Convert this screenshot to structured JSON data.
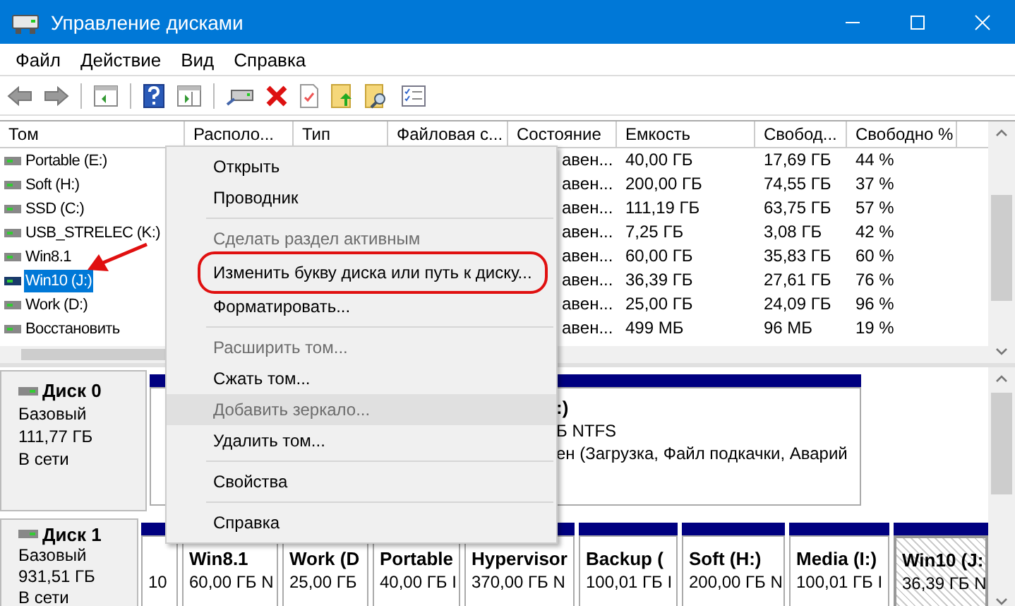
{
  "window": {
    "title": "Управление дисками"
  },
  "menu": [
    "Файл",
    "Действие",
    "Вид",
    "Справка"
  ],
  "volumes": {
    "columns": [
      "Том",
      "Располо...",
      "Тип",
      "Файловая с...",
      "Состояние",
      "Емкость",
      "Свобод...",
      "Свободно %"
    ],
    "rows": [
      {
        "name": "Portable (E:)",
        "status": "авен...",
        "capacity": "40,00 ГБ",
        "free": "17,69 ГБ",
        "free_percent": "44 %",
        "selected": false
      },
      {
        "name": "Soft (H:)",
        "status": "авен...",
        "capacity": "200,00 ГБ",
        "free": "74,55 ГБ",
        "free_percent": "37 %",
        "selected": false
      },
      {
        "name": "SSD (C:)",
        "status": "авен...",
        "capacity": "111,19 ГБ",
        "free": "63,75 ГБ",
        "free_percent": "57 %",
        "selected": false
      },
      {
        "name": "USB_STRELEC (K:)",
        "status": "авен...",
        "capacity": "7,25 ГБ",
        "free": "3,08 ГБ",
        "free_percent": "42 %",
        "selected": false
      },
      {
        "name": "Win8.1",
        "status": "авен...",
        "capacity": "60,00 ГБ",
        "free": "35,83 ГБ",
        "free_percent": "60 %",
        "selected": false
      },
      {
        "name": "Win10 (J:)",
        "status": "авен...",
        "capacity": "36,39 ГБ",
        "free": "27,61 ГБ",
        "free_percent": "76 %",
        "selected": true
      },
      {
        "name": "Work (D:)",
        "status": "авен...",
        "capacity": "25,00 ГБ",
        "free": "24,09 ГБ",
        "free_percent": "96 %",
        "selected": false
      },
      {
        "name": "Восстановить",
        "status": "авен...",
        "capacity": "499 МБ",
        "free": "96 МБ",
        "free_percent": "19 %",
        "selected": false
      }
    ]
  },
  "context_menu": {
    "items": [
      {
        "kind": "item",
        "label": "Открыть",
        "disabled": false,
        "highlighted": false,
        "circled": false
      },
      {
        "kind": "item",
        "label": "Проводник",
        "disabled": false,
        "highlighted": false,
        "circled": false
      },
      {
        "kind": "separator"
      },
      {
        "kind": "item",
        "label": "Сделать раздел активным",
        "disabled": true,
        "highlighted": false,
        "circled": false
      },
      {
        "kind": "item",
        "label": "Изменить букву диска или путь к диску...",
        "disabled": false,
        "highlighted": false,
        "circled": true
      },
      {
        "kind": "item",
        "label": "Форматировать...",
        "disabled": false,
        "highlighted": false,
        "circled": false
      },
      {
        "kind": "separator"
      },
      {
        "kind": "item",
        "label": "Расширить том...",
        "disabled": true,
        "highlighted": false,
        "circled": false
      },
      {
        "kind": "item",
        "label": "Сжать том...",
        "disabled": false,
        "highlighted": false,
        "circled": false
      },
      {
        "kind": "item",
        "label": "Добавить зеркало...",
        "disabled": true,
        "highlighted": true,
        "circled": false
      },
      {
        "kind": "item",
        "label": "Удалить том...",
        "disabled": false,
        "highlighted": false,
        "circled": false
      },
      {
        "kind": "separator"
      },
      {
        "kind": "item",
        "label": "Свойства",
        "disabled": false,
        "highlighted": false,
        "circled": false
      },
      {
        "kind": "separator"
      },
      {
        "kind": "item",
        "label": "Справка",
        "disabled": false,
        "highlighted": false,
        "circled": false
      }
    ]
  },
  "disks": [
    {
      "name": "Диск 0",
      "type": "Базовый",
      "size": "111,77 ГБ",
      "status": "В сети",
      "partitions": [
        {
          "name": ":)",
          "size": "Б NTFS",
          "health": "ен (Загрузка, Файл подкачки, Аварий",
          "selected": false
        }
      ]
    },
    {
      "name": "Диск 1",
      "type": "Базовый",
      "size": "931,51 ГБ",
      "status": "В сети",
      "partitions": [
        {
          "size": "10",
          "selected": false
        },
        {
          "name": "Win8.1",
          "size": "60,00 ГБ N",
          "selected": false
        },
        {
          "name": "Work  (D",
          "size": "25,00 ГБ",
          "selected": false
        },
        {
          "name": "Portable",
          "size": "40,00 ГБ I",
          "selected": false
        },
        {
          "name": "Hypervisor",
          "size": "370,00 ГБ N",
          "selected": false
        },
        {
          "name": "Backup  (",
          "size": "100,01 ГБ I",
          "selected": false
        },
        {
          "name": "Soft  (H:)",
          "size": "200,00 ГБ N",
          "selected": false
        },
        {
          "name": "Media  (I:)",
          "size": "100,01 ГБ I",
          "selected": false
        },
        {
          "name": "Win10  (J:",
          "size": "36,39 ГБ N",
          "selected": true
        }
      ]
    }
  ]
}
